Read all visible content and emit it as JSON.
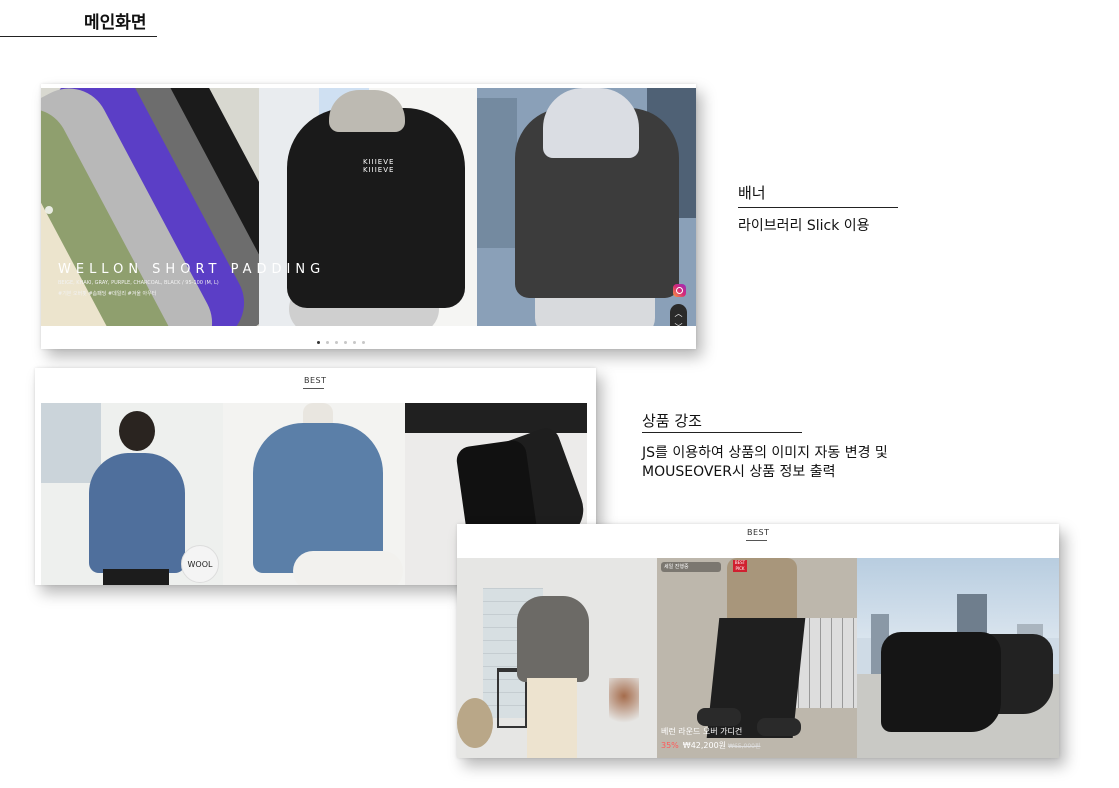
{
  "page": {
    "title": "메인화면"
  },
  "banner": {
    "headline": "WELLON SHORT PADDING",
    "spec_line": "BEIGE, KHAKI, GRAY, PURPLE, CHARCOAL, BLACK / 95-100 (M, L)",
    "note_line": "#기본 오버핏 #솜패딩 #데일리 #겨울 아우터",
    "jacket_logo": "KIIIEVE\nKIIIEVE",
    "slide_count": 6,
    "active_slide": 1,
    "scroll_up": "︿",
    "scroll_down": "﹀"
  },
  "annotations": {
    "banner": {
      "title": "배너",
      "desc": "라이브러리 Slick 이용"
    },
    "highlight": {
      "title": "상품 강조",
      "desc_line1": "JS를 이용하여 상품의 이미지 자동 변경 및",
      "desc_line2": "MOUSEOVER시 상품 정보 출력"
    }
  },
  "best1": {
    "label": "BEST",
    "badge": "WOOL"
  },
  "best2": {
    "label": "BEST",
    "tag": "세일 진행중",
    "new_badge": "BEST PICK",
    "product_name": "베런 라운드 오버 가디건",
    "discount": "35%",
    "price": "₩42,200원",
    "original_price": "₩65,000원"
  },
  "colors": {
    "rule": "#222222",
    "discount": "#ff5a5a",
    "badge_red": "#d0202f"
  }
}
